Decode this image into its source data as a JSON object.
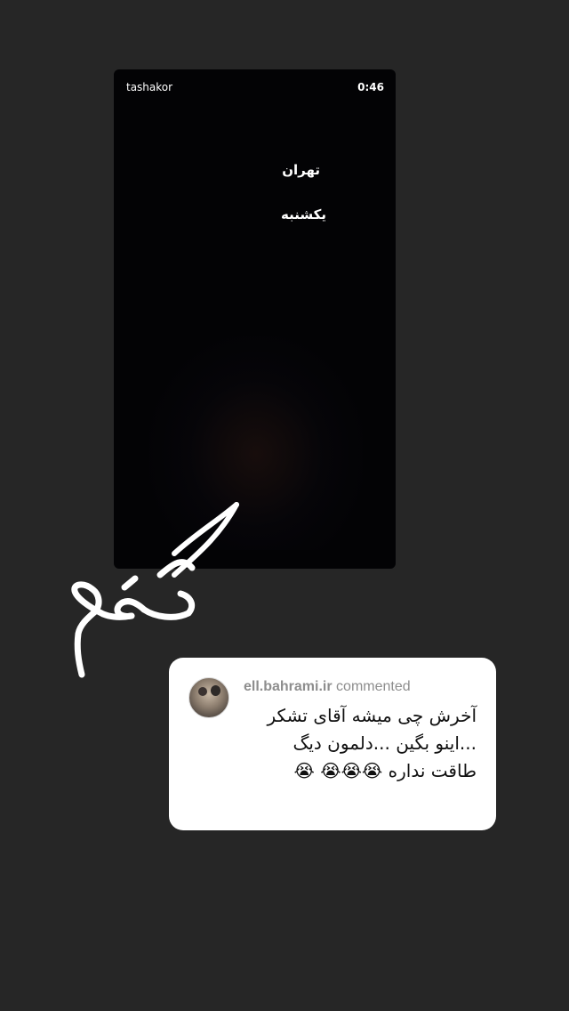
{
  "story": {
    "username": "tashakor",
    "time": "0:46",
    "lines": [
      "تهران",
      "یکشنبه"
    ]
  },
  "handwriting": {
    "text": "گفتم",
    "color": "#ffffff"
  },
  "comment": {
    "username": "ell.bahrami.ir",
    "action": "commented",
    "text": "آخرش چی میشه آقای تشکر ...اینو بگین ...دلمون دیگ طاقت نداره 😭😭😭 😭"
  },
  "colors": {
    "background": "#262626",
    "story_background": "#030305",
    "card_background": "#ffffff",
    "header_gray": "#8e8e8e"
  }
}
